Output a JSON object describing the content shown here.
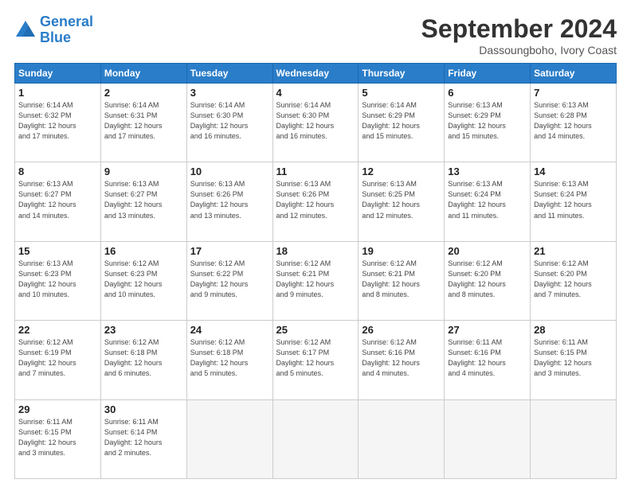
{
  "header": {
    "logo_general": "General",
    "logo_blue": "Blue",
    "month_title": "September 2024",
    "location": "Dassoungboho, Ivory Coast"
  },
  "days_of_week": [
    "Sunday",
    "Monday",
    "Tuesday",
    "Wednesday",
    "Thursday",
    "Friday",
    "Saturday"
  ],
  "weeks": [
    [
      {
        "day": "1",
        "info": "Sunrise: 6:14 AM\nSunset: 6:32 PM\nDaylight: 12 hours\nand 17 minutes."
      },
      {
        "day": "2",
        "info": "Sunrise: 6:14 AM\nSunset: 6:31 PM\nDaylight: 12 hours\nand 17 minutes."
      },
      {
        "day": "3",
        "info": "Sunrise: 6:14 AM\nSunset: 6:30 PM\nDaylight: 12 hours\nand 16 minutes."
      },
      {
        "day": "4",
        "info": "Sunrise: 6:14 AM\nSunset: 6:30 PM\nDaylight: 12 hours\nand 16 minutes."
      },
      {
        "day": "5",
        "info": "Sunrise: 6:14 AM\nSunset: 6:29 PM\nDaylight: 12 hours\nand 15 minutes."
      },
      {
        "day": "6",
        "info": "Sunrise: 6:13 AM\nSunset: 6:29 PM\nDaylight: 12 hours\nand 15 minutes."
      },
      {
        "day": "7",
        "info": "Sunrise: 6:13 AM\nSunset: 6:28 PM\nDaylight: 12 hours\nand 14 minutes."
      }
    ],
    [
      {
        "day": "8",
        "info": "Sunrise: 6:13 AM\nSunset: 6:27 PM\nDaylight: 12 hours\nand 14 minutes."
      },
      {
        "day": "9",
        "info": "Sunrise: 6:13 AM\nSunset: 6:27 PM\nDaylight: 12 hours\nand 13 minutes."
      },
      {
        "day": "10",
        "info": "Sunrise: 6:13 AM\nSunset: 6:26 PM\nDaylight: 12 hours\nand 13 minutes."
      },
      {
        "day": "11",
        "info": "Sunrise: 6:13 AM\nSunset: 6:26 PM\nDaylight: 12 hours\nand 12 minutes."
      },
      {
        "day": "12",
        "info": "Sunrise: 6:13 AM\nSunset: 6:25 PM\nDaylight: 12 hours\nand 12 minutes."
      },
      {
        "day": "13",
        "info": "Sunrise: 6:13 AM\nSunset: 6:24 PM\nDaylight: 12 hours\nand 11 minutes."
      },
      {
        "day": "14",
        "info": "Sunrise: 6:13 AM\nSunset: 6:24 PM\nDaylight: 12 hours\nand 11 minutes."
      }
    ],
    [
      {
        "day": "15",
        "info": "Sunrise: 6:13 AM\nSunset: 6:23 PM\nDaylight: 12 hours\nand 10 minutes."
      },
      {
        "day": "16",
        "info": "Sunrise: 6:12 AM\nSunset: 6:23 PM\nDaylight: 12 hours\nand 10 minutes."
      },
      {
        "day": "17",
        "info": "Sunrise: 6:12 AM\nSunset: 6:22 PM\nDaylight: 12 hours\nand 9 minutes."
      },
      {
        "day": "18",
        "info": "Sunrise: 6:12 AM\nSunset: 6:21 PM\nDaylight: 12 hours\nand 9 minutes."
      },
      {
        "day": "19",
        "info": "Sunrise: 6:12 AM\nSunset: 6:21 PM\nDaylight: 12 hours\nand 8 minutes."
      },
      {
        "day": "20",
        "info": "Sunrise: 6:12 AM\nSunset: 6:20 PM\nDaylight: 12 hours\nand 8 minutes."
      },
      {
        "day": "21",
        "info": "Sunrise: 6:12 AM\nSunset: 6:20 PM\nDaylight: 12 hours\nand 7 minutes."
      }
    ],
    [
      {
        "day": "22",
        "info": "Sunrise: 6:12 AM\nSunset: 6:19 PM\nDaylight: 12 hours\nand 7 minutes."
      },
      {
        "day": "23",
        "info": "Sunrise: 6:12 AM\nSunset: 6:18 PM\nDaylight: 12 hours\nand 6 minutes."
      },
      {
        "day": "24",
        "info": "Sunrise: 6:12 AM\nSunset: 6:18 PM\nDaylight: 12 hours\nand 5 minutes."
      },
      {
        "day": "25",
        "info": "Sunrise: 6:12 AM\nSunset: 6:17 PM\nDaylight: 12 hours\nand 5 minutes."
      },
      {
        "day": "26",
        "info": "Sunrise: 6:12 AM\nSunset: 6:16 PM\nDaylight: 12 hours\nand 4 minutes."
      },
      {
        "day": "27",
        "info": "Sunrise: 6:11 AM\nSunset: 6:16 PM\nDaylight: 12 hours\nand 4 minutes."
      },
      {
        "day": "28",
        "info": "Sunrise: 6:11 AM\nSunset: 6:15 PM\nDaylight: 12 hours\nand 3 minutes."
      }
    ],
    [
      {
        "day": "29",
        "info": "Sunrise: 6:11 AM\nSunset: 6:15 PM\nDaylight: 12 hours\nand 3 minutes."
      },
      {
        "day": "30",
        "info": "Sunrise: 6:11 AM\nSunset: 6:14 PM\nDaylight: 12 hours\nand 2 minutes."
      },
      {
        "day": "",
        "info": ""
      },
      {
        "day": "",
        "info": ""
      },
      {
        "day": "",
        "info": ""
      },
      {
        "day": "",
        "info": ""
      },
      {
        "day": "",
        "info": ""
      }
    ]
  ]
}
